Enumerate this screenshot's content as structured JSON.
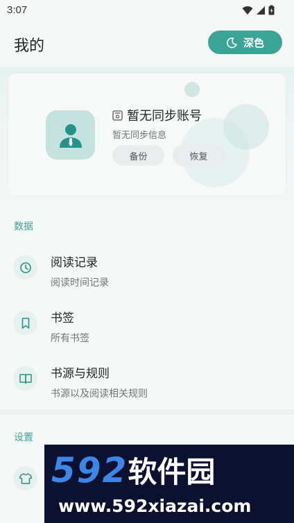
{
  "status_bar": {
    "time": "3:07"
  },
  "header": {
    "title": "我的",
    "theme_button_label": "深色"
  },
  "account": {
    "title": "暂无同步账号",
    "subtitle": "暂无同步信息",
    "backup_label": "备份",
    "restore_label": "恢复"
  },
  "data_section": {
    "title": "数据",
    "items": [
      {
        "title": "阅读记录",
        "subtitle": "阅读时间记录",
        "icon": "clock-icon"
      },
      {
        "title": "书签",
        "subtitle": "所有书签",
        "icon": "bookmark-icon"
      },
      {
        "title": "书源与规则",
        "subtitle": "书源以及阅读相关规则",
        "icon": "book-icon"
      }
    ]
  },
  "settings_section": {
    "title": "设置",
    "items": [
      {
        "icon": "shirt-icon"
      }
    ]
  },
  "watermark": {
    "brand_digits": "592",
    "brand_text": "软件园",
    "url": "www.592xiazai.com"
  },
  "colors": {
    "accent": "#3aa597",
    "background": "#f6f7f7",
    "icon_bg": "#e4f1ef"
  }
}
